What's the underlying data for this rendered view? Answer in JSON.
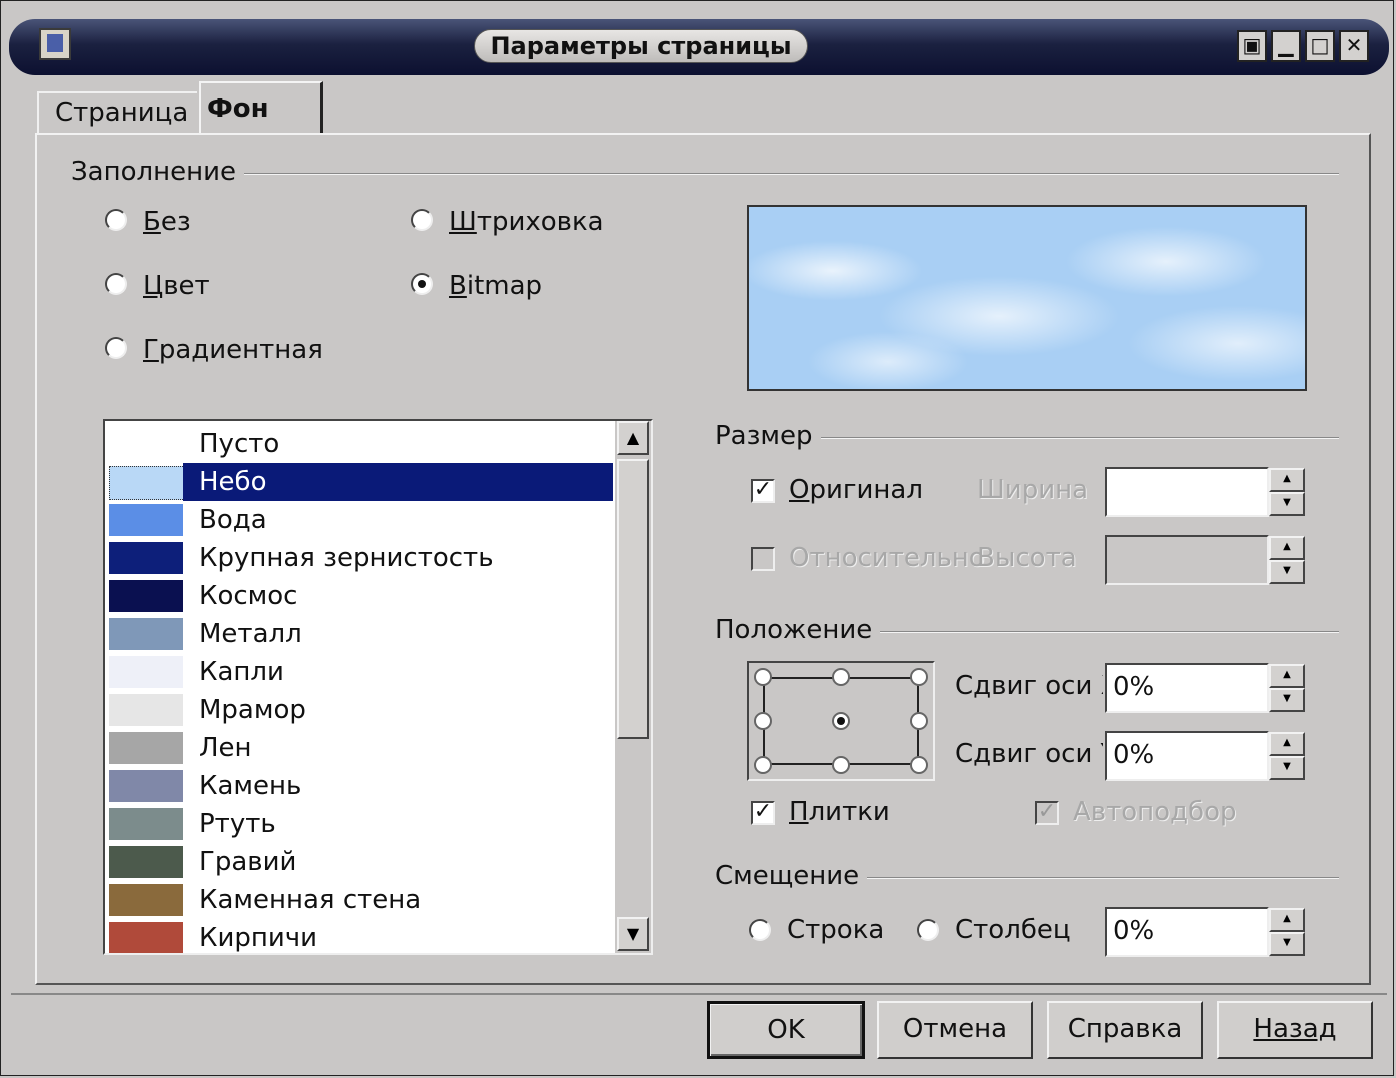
{
  "window": {
    "title": "Параметры страницы",
    "controls": [
      "▣",
      "▁",
      "□",
      "✕"
    ]
  },
  "tabs": [
    {
      "label": "Страница",
      "active": false
    },
    {
      "label": "Фон",
      "active": true
    }
  ],
  "fill": {
    "group_label": "Заполнение",
    "options": {
      "none": {
        "prefix": "Б",
        "rest": "ез",
        "selected": false
      },
      "color": {
        "prefix": "Ц",
        "rest": "вет",
        "selected": false
      },
      "gradient": {
        "prefix": "Г",
        "rest": "радиентная",
        "selected": false
      },
      "hatching": {
        "prefix": "Ш",
        "rest": "триховка",
        "selected": false
      },
      "bitmap": {
        "prefix": "B",
        "rest": "itmap",
        "selected": true
      }
    },
    "bitmaps": [
      {
        "name": "Пусто",
        "swatch": "#ffffff"
      },
      {
        "name": "Небо",
        "swatch": "#b9d8f6",
        "selected": true
      },
      {
        "name": "Вода",
        "swatch": "#5b8ee6"
      },
      {
        "name": "Крупная зернистость",
        "swatch": "#0d1f7a"
      },
      {
        "name": "Космос",
        "swatch": "#0a1050"
      },
      {
        "name": "Металл",
        "swatch": "#7f98b8"
      },
      {
        "name": "Капли",
        "swatch": "#eef0f8"
      },
      {
        "name": "Мрамор",
        "swatch": "#e6e6e6"
      },
      {
        "name": "Лен",
        "swatch": "#a6a6a6"
      },
      {
        "name": "Камень",
        "swatch": "#8088a8"
      },
      {
        "name": "Ртуть",
        "swatch": "#7c8c8c"
      },
      {
        "name": "Гравий",
        "swatch": "#4c5a4c"
      },
      {
        "name": "Каменная стена",
        "swatch": "#8a6a3c"
      },
      {
        "name": "Кирпичи",
        "swatch": "#b04a3a"
      }
    ]
  },
  "size": {
    "group_label": "Размер",
    "original": {
      "prefix": "О",
      "rest": "ригинал",
      "checked": true
    },
    "relative": {
      "text": "Относительно",
      "checked": false
    },
    "width_label": "Ширина",
    "height_label": "Высота",
    "width_value": "",
    "height_value": ""
  },
  "position": {
    "group_label": "Положение",
    "x_offset_label": "Сдвиг оси X",
    "y_offset_label": "Сдвиг оси Y",
    "x_offset": "0%",
    "y_offset": "0%",
    "tile": {
      "prefix": "П",
      "rest": "литки",
      "checked": true
    },
    "autofit": {
      "label": "Автоподбор",
      "checked": true
    }
  },
  "offset": {
    "group_label": "Смещение",
    "row": {
      "label": "Строка",
      "selected": false
    },
    "column": {
      "label": "Столбец",
      "selected": false
    },
    "value": "0%"
  },
  "buttons": {
    "ok": "OK",
    "cancel": "Отмена",
    "help": "Справка",
    "back": "Назад"
  }
}
